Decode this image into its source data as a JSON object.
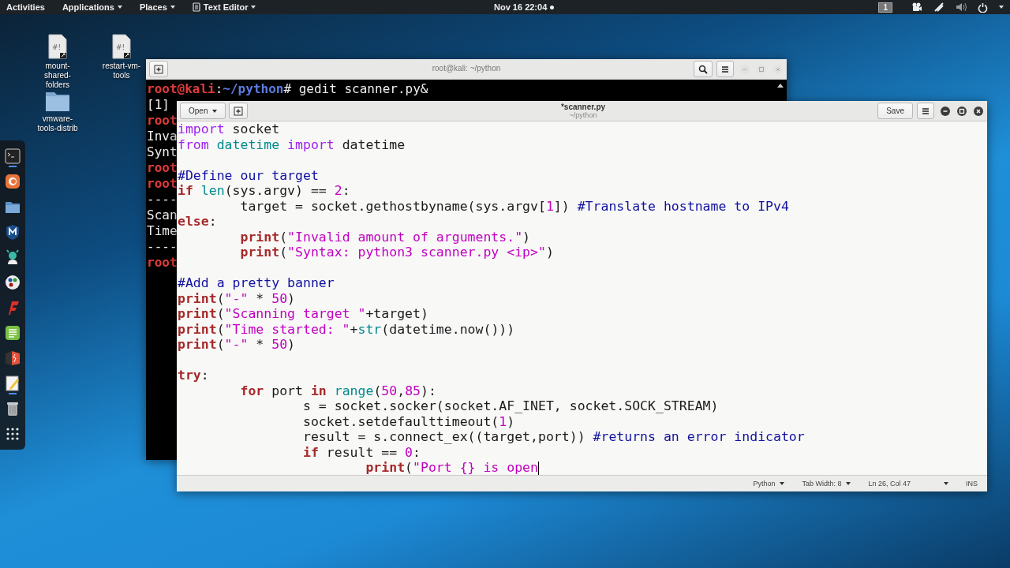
{
  "top_bar": {
    "activities": "Activities",
    "menus": [
      {
        "label": "Applications",
        "kind": "menu"
      },
      {
        "label": "Places",
        "kind": "menu"
      },
      {
        "label": "Text Editor",
        "kind": "app"
      }
    ],
    "clock": "Nov 16 22:04",
    "workspace": "1"
  },
  "desktop_icons": [
    {
      "label": "mount-shared-folders",
      "kind": "script",
      "glyph": "#!"
    },
    {
      "label": "restart-vm-tools",
      "kind": "script",
      "glyph": "#!"
    },
    {
      "label": "vmware-tools-distrib",
      "kind": "folder"
    }
  ],
  "dock": [
    {
      "kind": "terminal",
      "running": true
    },
    {
      "kind": "browser",
      "running": false
    },
    {
      "kind": "files",
      "running": false
    },
    {
      "kind": "shield",
      "running": false
    },
    {
      "kind": "character",
      "running": false
    },
    {
      "kind": "dots",
      "running": false
    },
    {
      "kind": "flash",
      "running": false
    },
    {
      "kind": "notes",
      "running": false
    },
    {
      "kind": "burst",
      "running": false
    },
    {
      "kind": "editor",
      "running": true
    },
    {
      "kind": "trash",
      "running": false
    },
    {
      "kind": "grid",
      "running": false
    }
  ],
  "terminal": {
    "title": "root@kali: ~/python",
    "lines": [
      [
        {
          "kind": "user",
          "text": "root@kali"
        },
        {
          "kind": "plain",
          "text": ":"
        },
        {
          "kind": "path",
          "text": "~/python"
        },
        {
          "kind": "plain",
          "text": "# gedit scanner.py&"
        }
      ],
      [
        {
          "kind": "plain",
          "text": "[1]"
        }
      ],
      [
        {
          "kind": "user",
          "text": "root"
        }
      ],
      [
        {
          "kind": "plain",
          "text": "Inva"
        }
      ],
      [
        {
          "kind": "plain",
          "text": "Synt"
        }
      ],
      [
        {
          "kind": "user",
          "text": "root"
        }
      ],
      [
        {
          "kind": "user",
          "text": "root"
        }
      ],
      [
        {
          "kind": "plain",
          "text": "----"
        }
      ],
      [
        {
          "kind": "plain",
          "text": "Scan"
        }
      ],
      [
        {
          "kind": "plain",
          "text": "Time"
        }
      ],
      [
        {
          "kind": "plain",
          "text": "----"
        }
      ],
      [
        {
          "kind": "user",
          "text": "root"
        }
      ]
    ]
  },
  "editor": {
    "title": "*scanner.py",
    "subtitle": "~/python",
    "open_button": "Open",
    "save_button": "Save",
    "lines": [
      [
        {
          "kind": "import",
          "text": "import "
        },
        {
          "kind": "plain",
          "text": "socket"
        }
      ],
      [
        {
          "kind": "import",
          "text": "from "
        },
        {
          "kind": "builtin",
          "text": "datetime "
        },
        {
          "kind": "import",
          "text": "import "
        },
        {
          "kind": "plain",
          "text": "datetime"
        }
      ],
      [
        {
          "kind": "blank"
        }
      ],
      [
        {
          "kind": "comment",
          "text": "#Define our target"
        }
      ],
      [
        {
          "kind": "keyword",
          "text": "if "
        },
        {
          "kind": "builtin",
          "text": "len"
        },
        {
          "kind": "plain",
          "text": "(sys.argv) == "
        },
        {
          "kind": "number",
          "text": "2"
        },
        {
          "kind": "plain",
          "text": ":"
        }
      ],
      [
        {
          "kind": "plain",
          "text": "\ttarget = socket.gethostbyname(sys.argv["
        },
        {
          "kind": "number",
          "text": "1"
        },
        {
          "kind": "plain",
          "text": "]) "
        },
        {
          "kind": "comment",
          "text": "#Translate hostname to IPv4"
        }
      ],
      [
        {
          "kind": "keyword",
          "text": "else"
        },
        {
          "kind": "plain",
          "text": ":"
        }
      ],
      [
        {
          "kind": "keyword",
          "text": "\tprint"
        },
        {
          "kind": "plain",
          "text": "("
        },
        {
          "kind": "string",
          "text": "\"Invalid amount of arguments.\""
        },
        {
          "kind": "plain",
          "text": ")"
        }
      ],
      [
        {
          "kind": "keyword",
          "text": "\tprint"
        },
        {
          "kind": "plain",
          "text": "("
        },
        {
          "kind": "string",
          "text": "\"Syntax: python3 scanner.py <ip>\""
        },
        {
          "kind": "plain",
          "text": ")"
        }
      ],
      [
        {
          "kind": "blank"
        }
      ],
      [
        {
          "kind": "comment",
          "text": "#Add a pretty banner"
        }
      ],
      [
        {
          "kind": "keyword",
          "text": "print"
        },
        {
          "kind": "plain",
          "text": "("
        },
        {
          "kind": "string",
          "text": "\"-\""
        },
        {
          "kind": "plain",
          "text": " * "
        },
        {
          "kind": "number",
          "text": "50"
        },
        {
          "kind": "plain",
          "text": ")"
        }
      ],
      [
        {
          "kind": "keyword",
          "text": "print"
        },
        {
          "kind": "plain",
          "text": "("
        },
        {
          "kind": "string",
          "text": "\"Scanning target \""
        },
        {
          "kind": "plain",
          "text": "+target)"
        }
      ],
      [
        {
          "kind": "keyword",
          "text": "print"
        },
        {
          "kind": "plain",
          "text": "("
        },
        {
          "kind": "string",
          "text": "\"Time started: \""
        },
        {
          "kind": "plain",
          "text": "+"
        },
        {
          "kind": "builtin",
          "text": "str"
        },
        {
          "kind": "plain",
          "text": "(datetime.now()))"
        }
      ],
      [
        {
          "kind": "keyword",
          "text": "print"
        },
        {
          "kind": "plain",
          "text": "("
        },
        {
          "kind": "string",
          "text": "\"-\""
        },
        {
          "kind": "plain",
          "text": " * "
        },
        {
          "kind": "number",
          "text": "50"
        },
        {
          "kind": "plain",
          "text": ")"
        }
      ],
      [
        {
          "kind": "blank"
        }
      ],
      [
        {
          "kind": "keyword",
          "text": "try"
        },
        {
          "kind": "plain",
          "text": ":"
        }
      ],
      [
        {
          "kind": "keyword",
          "text": "\tfor"
        },
        {
          "kind": "plain",
          "text": " port "
        },
        {
          "kind": "keyword",
          "text": "in "
        },
        {
          "kind": "builtin",
          "text": "range"
        },
        {
          "kind": "plain",
          "text": "("
        },
        {
          "kind": "number",
          "text": "50"
        },
        {
          "kind": "plain",
          "text": ","
        },
        {
          "kind": "number",
          "text": "85"
        },
        {
          "kind": "plain",
          "text": "):"
        }
      ],
      [
        {
          "kind": "plain",
          "text": "\t\ts = socket.socker(socket.AF_INET, socket.SOCK_STREAM)"
        }
      ],
      [
        {
          "kind": "plain",
          "text": "\t\tsocket.setdefaulttimeout("
        },
        {
          "kind": "number",
          "text": "1"
        },
        {
          "kind": "plain",
          "text": ")"
        }
      ],
      [
        {
          "kind": "plain",
          "text": "\t\tresult = s.connect_ex((target,port)) "
        },
        {
          "kind": "comment",
          "text": "#returns an error indicator"
        }
      ],
      [
        {
          "kind": "keyword",
          "text": "\t\tif"
        },
        {
          "kind": "plain",
          "text": " result == "
        },
        {
          "kind": "number",
          "text": "0"
        },
        {
          "kind": "plain",
          "text": ":"
        }
      ],
      [
        {
          "kind": "keyword",
          "text": "\t\t\tprint"
        },
        {
          "kind": "plain",
          "text": "("
        },
        {
          "kind": "string",
          "text": "\"Port {} is open"
        }
      ]
    ],
    "status": {
      "language": "Python",
      "tab_width": "Tab Width: 8",
      "position": "Ln 26, Col 47",
      "mode": "INS"
    }
  }
}
